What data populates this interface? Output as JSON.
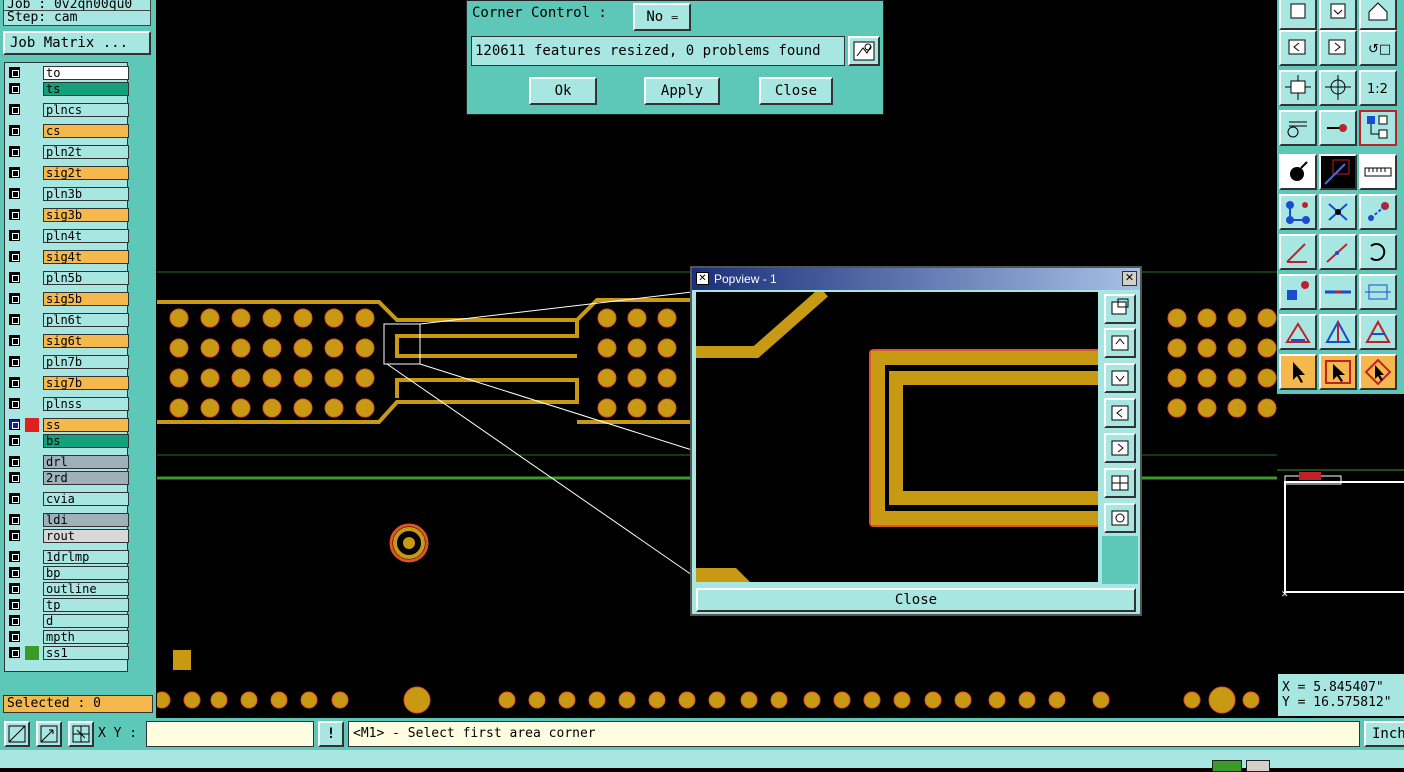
{
  "left_panel": {
    "job_label": "Job : 0v2qn00qu0",
    "step_label": "Step: cam",
    "job_matrix_button": "Job Matrix ...",
    "selected_label": "Selected : 0",
    "layers": [
      {
        "name": "to",
        "color": "#ffffff"
      },
      {
        "name": "ts",
        "color": "#13a07a"
      },
      {
        "name": "plncs",
        "color": "#a8e6e2"
      },
      {
        "name": "cs",
        "color": "#f5b84c"
      },
      {
        "name": "pln2t",
        "color": "#a8e6e2"
      },
      {
        "name": "sig2t",
        "color": "#f5b84c"
      },
      {
        "name": "pln3b",
        "color": "#a8e6e2"
      },
      {
        "name": "sig3b",
        "color": "#f5b84c"
      },
      {
        "name": "pln4t",
        "color": "#a8e6e2"
      },
      {
        "name": "sig4t",
        "color": "#f5b84c"
      },
      {
        "name": "pln5b",
        "color": "#a8e6e2"
      },
      {
        "name": "sig5b",
        "color": "#f5b84c"
      },
      {
        "name": "pln6t",
        "color": "#a8e6e2"
      },
      {
        "name": "sig6t",
        "color": "#f5b84c"
      },
      {
        "name": "pln7b",
        "color": "#a8e6e2"
      },
      {
        "name": "sig7b",
        "color": "#f5b84c"
      },
      {
        "name": "plnss",
        "color": "#a8e6e2"
      },
      {
        "name": "ss",
        "color": "#f5b84c"
      },
      {
        "name": "bs",
        "color": "#13a07a"
      },
      {
        "name": "drl",
        "color": "#9fb0b8"
      },
      {
        "name": "2rd",
        "color": "#9fb0b8"
      },
      {
        "name": "cvia",
        "color": "#a8e6e2"
      },
      {
        "name": "ldi",
        "color": "#9fb0b8"
      },
      {
        "name": "rout",
        "color": "#d8d8d8"
      },
      {
        "name": "1drlmp",
        "color": "#a8e6e2"
      },
      {
        "name": "bp",
        "color": "#a8e6e2"
      },
      {
        "name": "outline",
        "color": "#a8e6e2"
      },
      {
        "name": "tp",
        "color": "#a8e6e2"
      },
      {
        "name": "d",
        "color": "#a8e6e2"
      },
      {
        "name": "mpth",
        "color": "#a8e6e2"
      },
      {
        "name": "ss1",
        "color": "#a8e6e2"
      }
    ]
  },
  "dialog": {
    "corner_control_label": "Corner Control :",
    "corner_control_value": "No",
    "result_text": "120611 features resized, 0 problems found",
    "ok_button": "Ok",
    "apply_button": "Apply",
    "close_button": "Close"
  },
  "popview": {
    "title": "Popview - 1",
    "close_button": "Close"
  },
  "status_bar": {
    "xy_label": "X Y :",
    "xy_value": "",
    "prompt": "<M1> - Select first area corner",
    "units_button": "Inch"
  },
  "coords": {
    "x": "X = 5.845407\"",
    "y": "Y = 16.575812\""
  },
  "colors": {
    "panel": "#5ec8b8",
    "panel_light": "#a8e6e2",
    "copper": "#c89a14",
    "board_bg": "#000000"
  }
}
